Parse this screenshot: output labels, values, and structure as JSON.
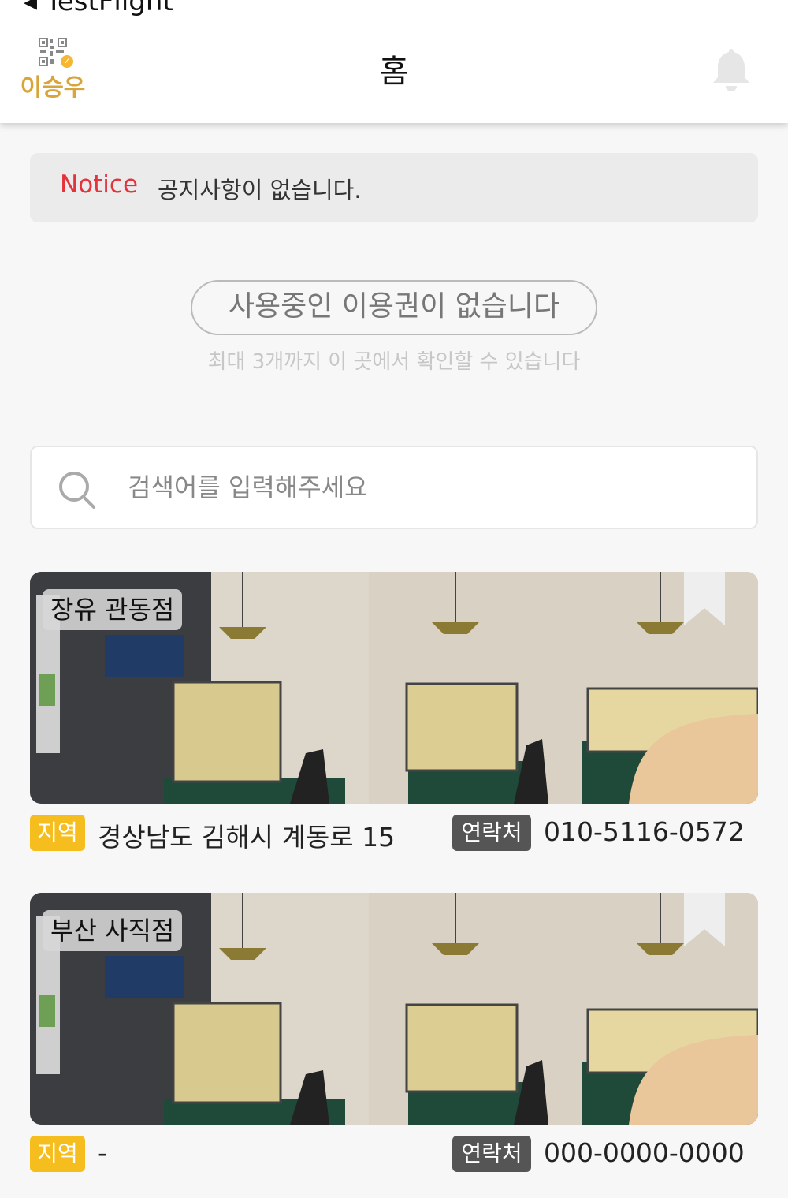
{
  "statusbar": {
    "back_label": "◂ TestFlight"
  },
  "header": {
    "username": "이승우",
    "title": "홈"
  },
  "notice": {
    "label": "Notice",
    "text": "공지사항이 없습니다."
  },
  "pass": {
    "empty_text": "사용중인 이용권이 없습니다",
    "sub_text": "최대 3개까지 이 곳에서 확인할 수 있습니다"
  },
  "search": {
    "placeholder": "검색어를 입력해주세요",
    "value": ""
  },
  "labels": {
    "region": "지역",
    "contact": "연락처"
  },
  "stores": [
    {
      "name": "장유 관동점",
      "region": "경상남도 김해시 계동로 15",
      "phone": "010-5116-0572"
    },
    {
      "name": "부산 사직점",
      "region": "-",
      "phone": "000-0000-0000"
    }
  ],
  "colors": {
    "accent": "#f5be1e",
    "username": "#d8a53a",
    "notice_label": "#e3343d",
    "contact_badge": "#555555"
  },
  "icons": {
    "logo": "qr-code-icon",
    "bell": "bell-icon",
    "search": "search-icon",
    "bookmark": "bookmark-icon"
  }
}
